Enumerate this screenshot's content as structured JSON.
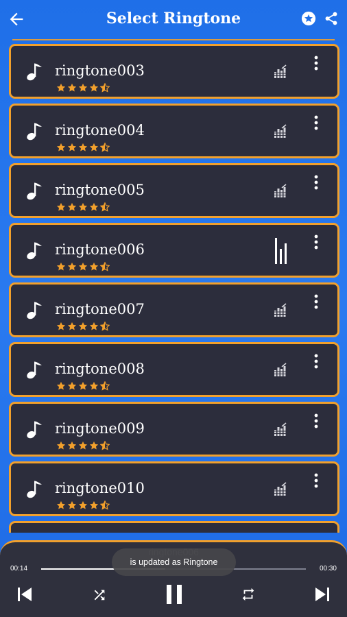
{
  "header": {
    "title": "Select Ringtone"
  },
  "ringtones": [
    {
      "name": "ringtone003",
      "playing": false
    },
    {
      "name": "ringtone004",
      "playing": false
    },
    {
      "name": "ringtone005",
      "playing": false
    },
    {
      "name": "ringtone006",
      "playing": true
    },
    {
      "name": "ringtone007",
      "playing": false
    },
    {
      "name": "ringtone008",
      "playing": false
    },
    {
      "name": "ringtone009",
      "playing": false
    },
    {
      "name": "ringtone010",
      "playing": false
    }
  ],
  "rating": {
    "stars": 4.5,
    "max": 5
  },
  "player": {
    "now_playing": "ringtone006",
    "elapsed": "00:14",
    "duration": "00:30",
    "progress": 0.47
  },
  "toast": {
    "message": "is updated as Ringtone"
  },
  "colors": {
    "accent": "#f2a02c",
    "card": "#2c2d3c",
    "background": "#1f6fe8",
    "player": "#2f303d"
  }
}
